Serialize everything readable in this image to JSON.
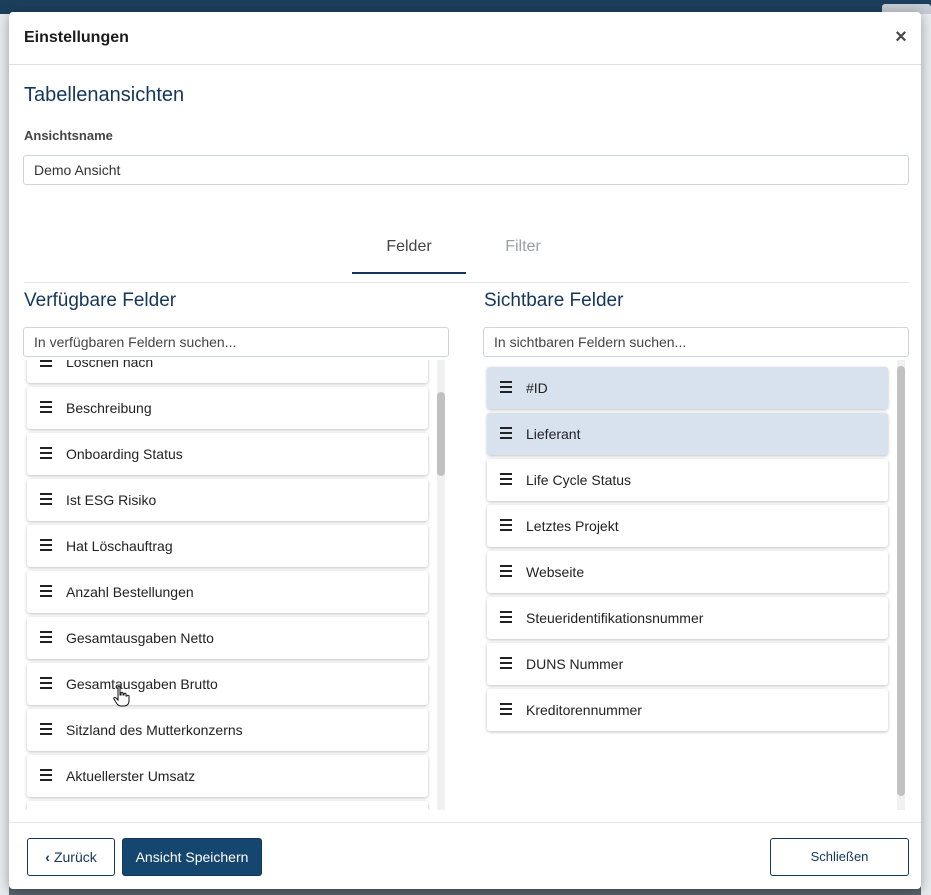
{
  "modal": {
    "title": "Einstellungen",
    "close_icon": "×"
  },
  "section": {
    "title": "Tabellenansichten",
    "name_label": "Ansichtsname",
    "name_value": "Demo Ansicht"
  },
  "tabs": [
    {
      "label": "Felder",
      "active": true
    },
    {
      "label": "Filter",
      "active": false
    }
  ],
  "available": {
    "title": "Verfügbare Felder",
    "search_placeholder": "In verfügbaren Feldern suchen...",
    "items": [
      "Löschen nach",
      "Beschreibung",
      "Onboarding Status",
      "Ist ESG Risiko",
      "Hat Löschauftrag",
      "Anzahl Bestellungen",
      "Gesamtausgaben Netto",
      "Gesamtausgaben Brutto",
      "Sitzland des Mutterkonzerns",
      "Aktuellerster Umsatz"
    ]
  },
  "visible": {
    "title": "Sichtbare Felder",
    "search_placeholder": "In sichtbaren Feldern suchen...",
    "items": [
      {
        "label": "#ID",
        "selected": true
      },
      {
        "label": "Lieferant",
        "selected": true
      },
      {
        "label": "Life Cycle Status",
        "selected": false
      },
      {
        "label": "Letztes Projekt",
        "selected": false
      },
      {
        "label": "Webseite",
        "selected": false
      },
      {
        "label": "Steueridentifikationsnummer",
        "selected": false
      },
      {
        "label": "DUNS Nummer",
        "selected": false
      },
      {
        "label": "Kreditorennummer",
        "selected": false
      }
    ]
  },
  "footer": {
    "back_label": "Zurück",
    "save_label": "Ansicht Speichern",
    "close_label": "Schließen"
  },
  "colors": {
    "accent": "#14365b",
    "primary_button": "#14466f",
    "selected_row": "#d8e2ee"
  }
}
